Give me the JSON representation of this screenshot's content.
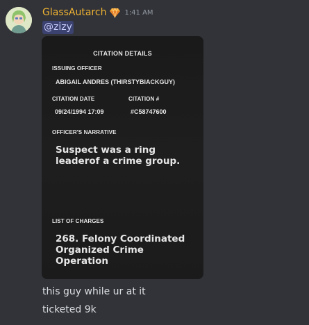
{
  "message": {
    "username": "GlassAutarch",
    "badge_icon": "orange-gem-icon",
    "timestamp": "1:41 AM",
    "mention": "@zizy",
    "lines": [
      "this guy while ur at it",
      "ticketed 9k"
    ]
  },
  "citation": {
    "title": "CITATION DETAILS",
    "issuing_officer_label": "ISSUING OFFICER",
    "issuing_officer_value": "ABIGAIL ANDRES (THIRSTYBIACKGUY)",
    "citation_date_label": "CITATION DATE",
    "citation_date_value": "09/24/1994 17:09",
    "citation_number_label": "CITATION #",
    "citation_number_value": "#C58747600",
    "narrative_label": "OFFICER'S NARRATIVE",
    "narrative_text": "Suspect was a ring leaderof a crime group.",
    "charges_label": "LIST OF CHARGES",
    "charges_text": "268. Felony Coordinated Organized Crime Operation"
  },
  "colors": {
    "background": "#313338",
    "username": "#f0b232",
    "mention_bg": "#3c4270",
    "mention_text": "#c9cdfb",
    "card_bg": "#1c1c1c"
  }
}
